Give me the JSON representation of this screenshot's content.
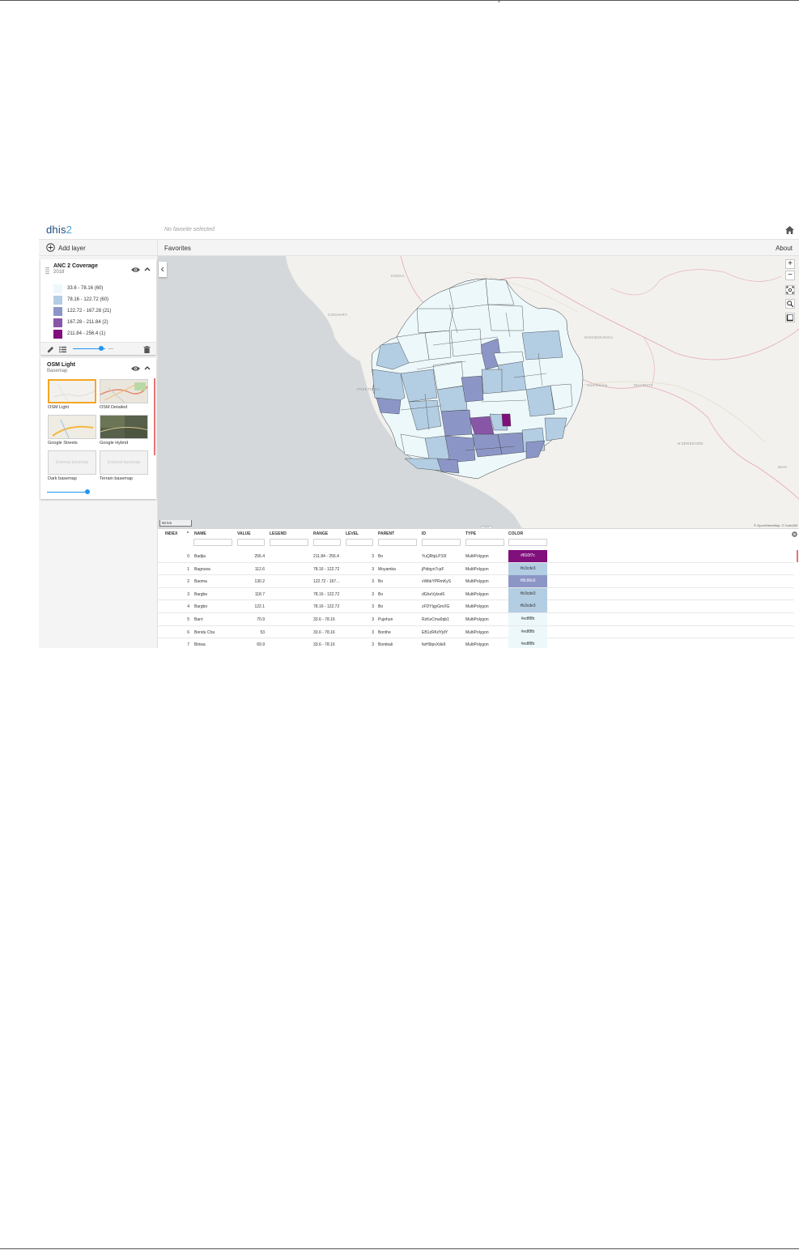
{
  "header": {
    "logo_main": "dhis",
    "logo_accent": "2",
    "favorite_title": "No favorite selected"
  },
  "toolbar": {
    "add_layer": "Add layer",
    "favorites": "Favorites",
    "about": "About"
  },
  "thematic_layer": {
    "title": "ANC 2 Coverage",
    "period": "2018",
    "legend": [
      {
        "label": "33.6 - 78.16 (60)",
        "color": "#edf8fb"
      },
      {
        "label": "78.16 - 122.72 (60)",
        "color": "#b3cde3"
      },
      {
        "label": "122.72 - 167.28 (21)",
        "color": "#8c96c6"
      },
      {
        "label": "167.28 - 211.84 (2)",
        "color": "#8856a7"
      },
      {
        "label": "211.84 - 256.4 (1)",
        "color": "#810f7c"
      }
    ],
    "opacity": 0.8
  },
  "basemap_layer": {
    "title": "OSM Light",
    "subtitle": "Basemap",
    "tiles": [
      {
        "label": "OSM Light",
        "selected": true
      },
      {
        "label": "OSM Detailed",
        "selected": false
      },
      {
        "label": "Google Streets",
        "selected": false
      },
      {
        "label": "Google Hybrid",
        "selected": false
      },
      {
        "label": "Dark basemap",
        "placeholder": "External basemap",
        "selected": false
      },
      {
        "label": "Terrain basemap",
        "placeholder": "External basemap",
        "selected": false
      }
    ],
    "opacity": 0.8
  },
  "map": {
    "labels": [
      "KINDIA",
      "CONAKRY",
      "KISSIDOUGOU",
      "Guéckédou",
      "MACENTA",
      "N'ZÉRÉKORÉ",
      "MAN",
      "FREETOWN"
    ],
    "scale": "50 km",
    "attribution": "© OpenStreetMap, © CartoDB",
    "zoom_in": "+",
    "zoom_out": "−"
  },
  "table": {
    "columns": [
      "INDEX",
      "NAME",
      "VALUE",
      "LEGEND",
      "RANGE",
      "LEVEL",
      "PARENT",
      "ID",
      "TYPE",
      "COLOR"
    ],
    "sort_indicator": "*",
    "rows": [
      {
        "index": "0",
        "name": "Badjia",
        "value": "256.4",
        "legend": "",
        "range": "211.84 - 256.4",
        "level": "3",
        "parent": "Bo",
        "id": "YuQRtpLP10I",
        "type": "MultiPolygon",
        "color": "#810f7c"
      },
      {
        "index": "1",
        "name": "Bagruwa",
        "value": "112.6",
        "legend": "",
        "range": "78.16 - 122.72",
        "level": "3",
        "parent": "Moyamba",
        "id": "jPidqyo7cpF",
        "type": "MultiPolygon",
        "color": "#b3cde3"
      },
      {
        "index": "2",
        "name": "Baoma",
        "value": "130.2",
        "legend": "",
        "range": "122.72 - 167...",
        "level": "3",
        "parent": "Bo",
        "id": "vWbkYPRmKyS",
        "type": "MultiPolygon",
        "color": "#8c96c6"
      },
      {
        "index": "3",
        "name": "Bargbe",
        "value": "118.7",
        "legend": "",
        "range": "78.16 - 122.72",
        "level": "3",
        "parent": "Bo",
        "id": "dGheVylzol6",
        "type": "MultiPolygon",
        "color": "#b3cde3"
      },
      {
        "index": "4",
        "name": "Bargbo",
        "value": "122.1",
        "legend": "",
        "range": "78.16 - 122.72",
        "level": "3",
        "parent": "Bo",
        "id": "zFDYIgyGmXG",
        "type": "MultiPolygon",
        "color": "#b3cde3"
      },
      {
        "index": "5",
        "name": "Barri",
        "value": "70.9",
        "legend": "",
        "range": "33.6 - 78.16",
        "level": "3",
        "parent": "Pujehun",
        "id": "RzKeCma9qb1",
        "type": "MultiPolygon",
        "color": "#edf8fb"
      },
      {
        "index": "6",
        "name": "Bendu Cha",
        "value": "53",
        "legend": "",
        "range": "33.6 - 78.16",
        "level": "3",
        "parent": "Bonthe",
        "id": "EB1zRKdYjdY",
        "type": "MultiPolygon",
        "color": "#edf8fb"
      },
      {
        "index": "7",
        "name": "Biriwa",
        "value": "69.9",
        "legend": "",
        "range": "33.6 - 78.16",
        "level": "3",
        "parent": "Bombali",
        "id": "fwH9ipvXde9",
        "type": "MultiPolygon",
        "color": "#edf8fb"
      }
    ]
  }
}
